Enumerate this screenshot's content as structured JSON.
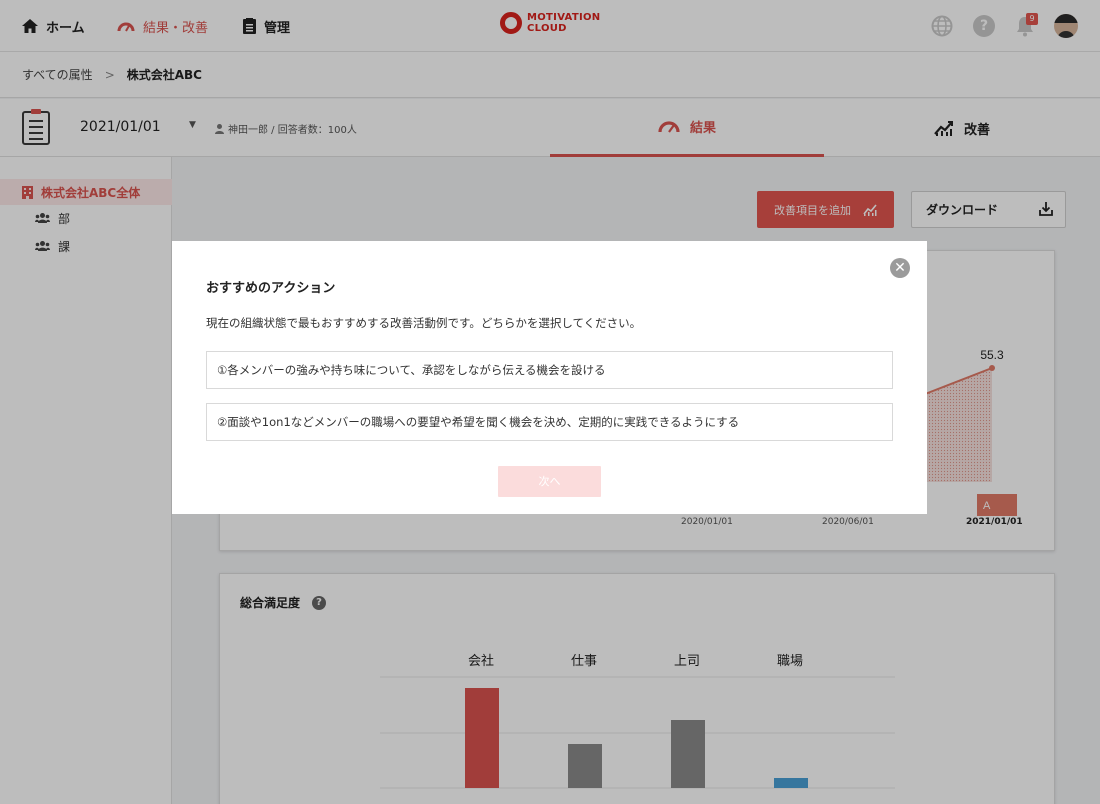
{
  "topnav": {
    "home_label": "ホーム",
    "results_label": "結果・改善",
    "manage_label": "管理",
    "logo_line1": "MOTIVATION",
    "logo_line2": "CLOUD",
    "help_glyph": "?",
    "notification_count": "9"
  },
  "breadcrumb": {
    "root": "すべての属性",
    "separator": ">",
    "current": "株式会社ABC"
  },
  "subheader": {
    "date": "2021/01/01",
    "meta": "神田一郎 / 回答者数：100人",
    "tab_results": "結果",
    "tab_improve": "改善"
  },
  "sidebar": {
    "items": [
      {
        "label": "株式会社ABC全体"
      },
      {
        "label": "部"
      },
      {
        "label": "課"
      }
    ]
  },
  "main": {
    "add_button": "改善項目を追加",
    "download_button": "ダウンロード"
  },
  "trend_card": {
    "last_value_label": "55.3",
    "grade_label": "A",
    "dates": [
      "2020/01/01",
      "2020/06/01",
      "2021/01/01"
    ]
  },
  "overall_card": {
    "title": "総合満足度",
    "help_glyph": "?"
  },
  "chart_data": [
    {
      "type": "area",
      "x": [
        "2020/01/01",
        "2020/06/01",
        "2021/01/01"
      ],
      "series": [
        {
          "values": [
            null,
            null,
            55.3
          ]
        }
      ],
      "annotations": [
        "55.3",
        "A"
      ]
    },
    {
      "type": "bar",
      "title": "総合満足度",
      "categories": [
        "会社",
        "仕事",
        "上司",
        "職場"
      ],
      "values": [
        100,
        44,
        68,
        10
      ],
      "colors": [
        "#d9534f",
        "#8a8a8a",
        "#8a8a8a",
        "#4a9fd5"
      ]
    }
  ],
  "modal": {
    "title": "おすすめのアクション",
    "description": "現在の組織状態で最もおすすめする改善活動例です。どちらかを選択してください。",
    "options": [
      {
        "label": "①各メンバーの強みや持ち味について、承認をしながら伝える機会を設ける"
      },
      {
        "label": "②面談や1on1などメンバーの職場への要望や希望を聞く機会を決め、定期的に実践できるようにする"
      }
    ],
    "next_button": "次へ",
    "close_glyph": "✕"
  },
  "colors": {
    "accent": "#d9534f",
    "brand": "#d9231d",
    "bar_gray": "#8a8a8a",
    "bar_blue": "#4a9fd5"
  }
}
